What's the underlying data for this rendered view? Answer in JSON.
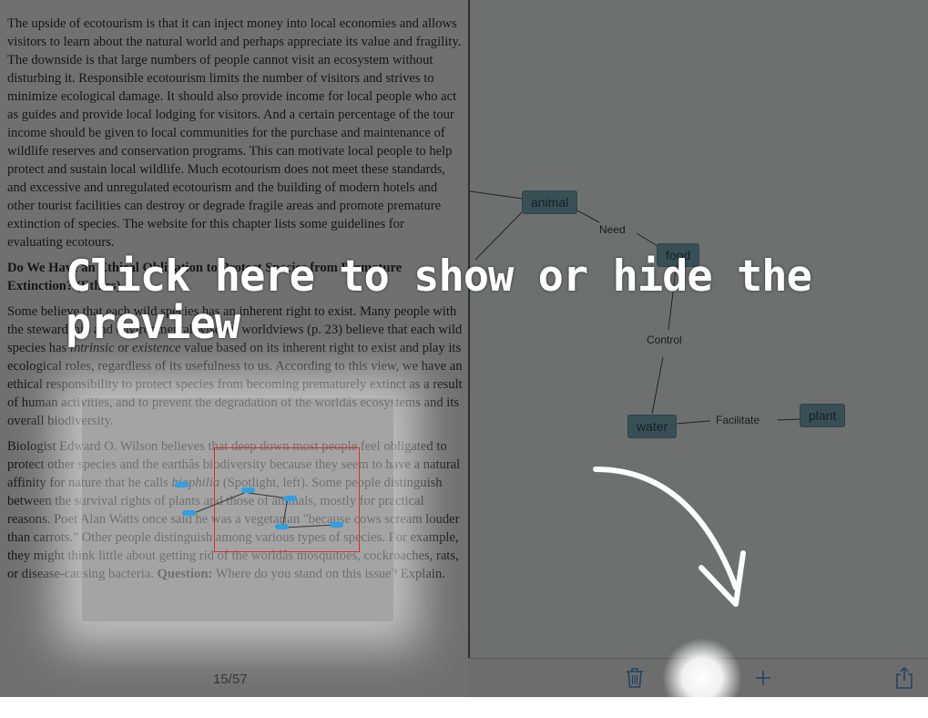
{
  "reader": {
    "paragraphs": [
      "The upside of ecotourism is that it can inject money into local economies and allows visitors to learn about the natural world and perhaps appreciate its value and fragility. The downside is that large numbers of people cannot visit an ecosystem without disturbing it. Responsible ecotourism limits the number of visitors and strives to minimize ecological damage. It should also provide income for local people who act as guides and provide local lodging for visitors. And a certain percentage of the tour income should be given to local communities for the purchase and maintenance of wildlife reserves and conservation programs. This can motivate local people to help protect and sustain local wildlife.  Much ecotourism does not meet these standards, and excessive and unregulated ecotourism and the building of modern hotels and other tourist facilities can destroy or degrade fragile areas and promote premature extinction of species. The website for this chapter lists some guidelines for evaluating ecotours."
    ],
    "heading": "Do We Have an Ethical Obligation to Protect Species from Premature Extinction? (Ethics)",
    "p2_a": "Some believe that each wild species has an inherent right to exist. Many people with the stewardship and environmental wisdom worldviews (p. 23) believe that each wild species has ",
    "p2_em1": "intrinsic",
    "p2_b": " or ",
    "p2_em2": "existence",
    "p2_c": " value based on its inherent right to exist and play its ecological roles, regardless of its usefulness to us. According to this view, we have an ethical responsibility to protect species from becoming prematurely extinct as a result of human activities, and to prevent the degradation of the worldâs ecosystems and its overall biodiversity.",
    "p3_a": "Biologist Edward O. Wilson believes that deep down most people feel obligated to protect other species and the earthâs biodiversity because they seem to have a natural affinity for nature that he calls ",
    "p3_em": "biophilia",
    "p3_b": " (Spotlight, left). Some people distinguish between the survival rights of plants and those of animals, mostly for practical reasons. Poet Alan Watts once said he was a vegetarian \"because cows scream louder than carrots.\" Other people distinguish among various types of species. For example, they might think little about getting rid of the worldâs mosquitoes, cockroaches, rats, or disease-causing bacteria. ",
    "p3_q": "Question:",
    "p3_c": " Where do you stand on this issue? Explain.",
    "page_indicator": "15/57"
  },
  "concept_map": {
    "nodes": {
      "animal": "animal",
      "food": "food",
      "water": "water",
      "plant": "plant"
    },
    "links": {
      "need": "Need",
      "control": "Control",
      "facilitate": "Facilitate"
    }
  },
  "toolbar": {
    "delete_icon": "trash-icon",
    "search_icon": "magnifier-icon",
    "add_icon": "plus-icon",
    "share_icon": "share-icon",
    "tint": "#2f8be8"
  },
  "tutorial": {
    "tip": "Click here to show or hide the preview"
  },
  "colors": {
    "node_fill": "#6aa9b7",
    "preview_node": "#2fa0e0",
    "viewport_border": "#e22b2b"
  }
}
